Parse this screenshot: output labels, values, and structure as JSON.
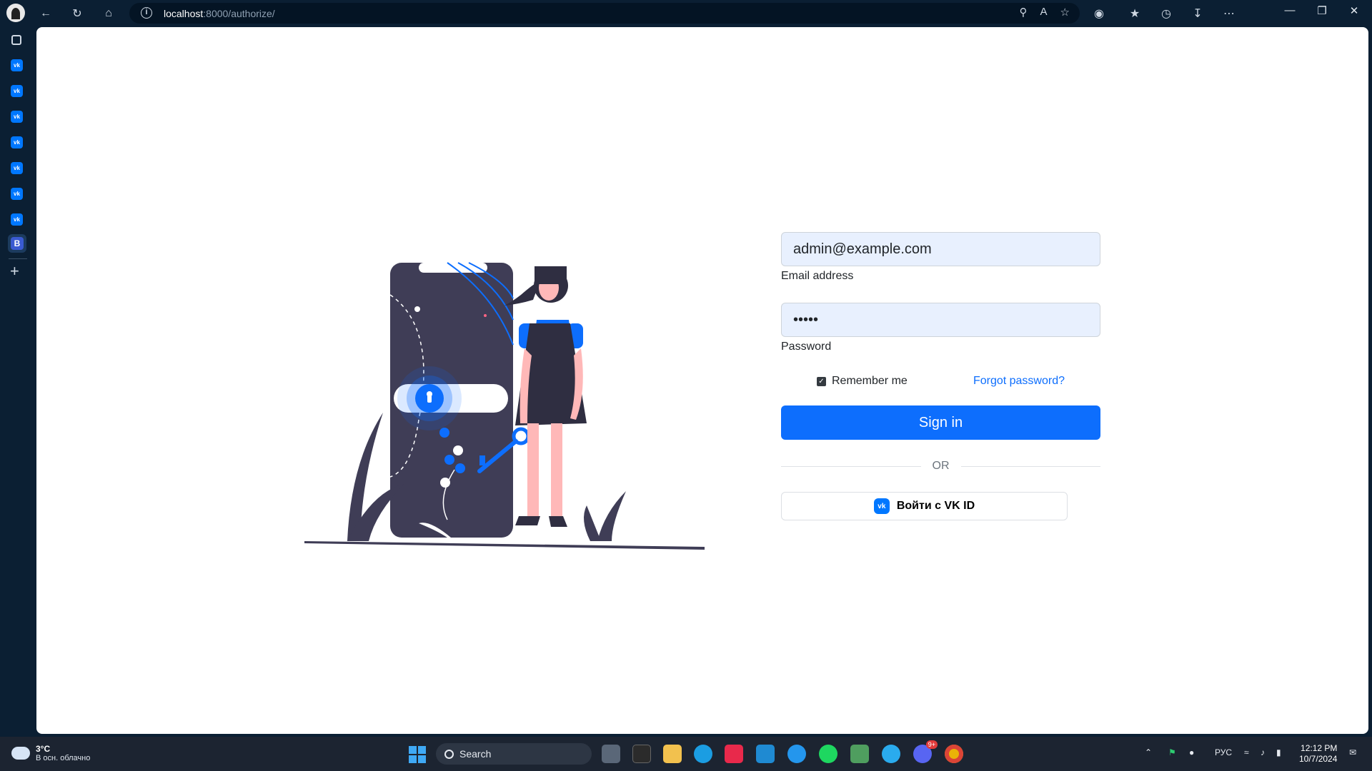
{
  "browser": {
    "url_host": "localhost",
    "url_rest": ":8000/authorize/"
  },
  "sidebar": {
    "items": [
      "vk",
      "vk",
      "vk",
      "vk",
      "vk",
      "vk",
      "vk"
    ],
    "b_label": "B"
  },
  "login": {
    "email_value": "admin@example.com",
    "email_label": "Email address",
    "password_value": "•••••",
    "password_label": "Password",
    "remember_label": "Remember me",
    "remember_checked": true,
    "forgot_label": "Forgot password?",
    "signin_label": "Sign in",
    "or_label": "OR",
    "vk_button_label": "Войти с VK ID",
    "vk_logo_text": "vk"
  },
  "taskbar": {
    "weather_temp": "3°C",
    "weather_desc": "В осн. облачно",
    "search_label": "Search",
    "lang": "РУС",
    "time": "12:12 PM",
    "date": "10/7/2024",
    "discord_badge": "9+"
  },
  "colors": {
    "accent": "#0d6efd",
    "vk": "#0077ff",
    "illustration_dark": "#3f3d56",
    "illustration_skin": "#ffb8b8"
  }
}
